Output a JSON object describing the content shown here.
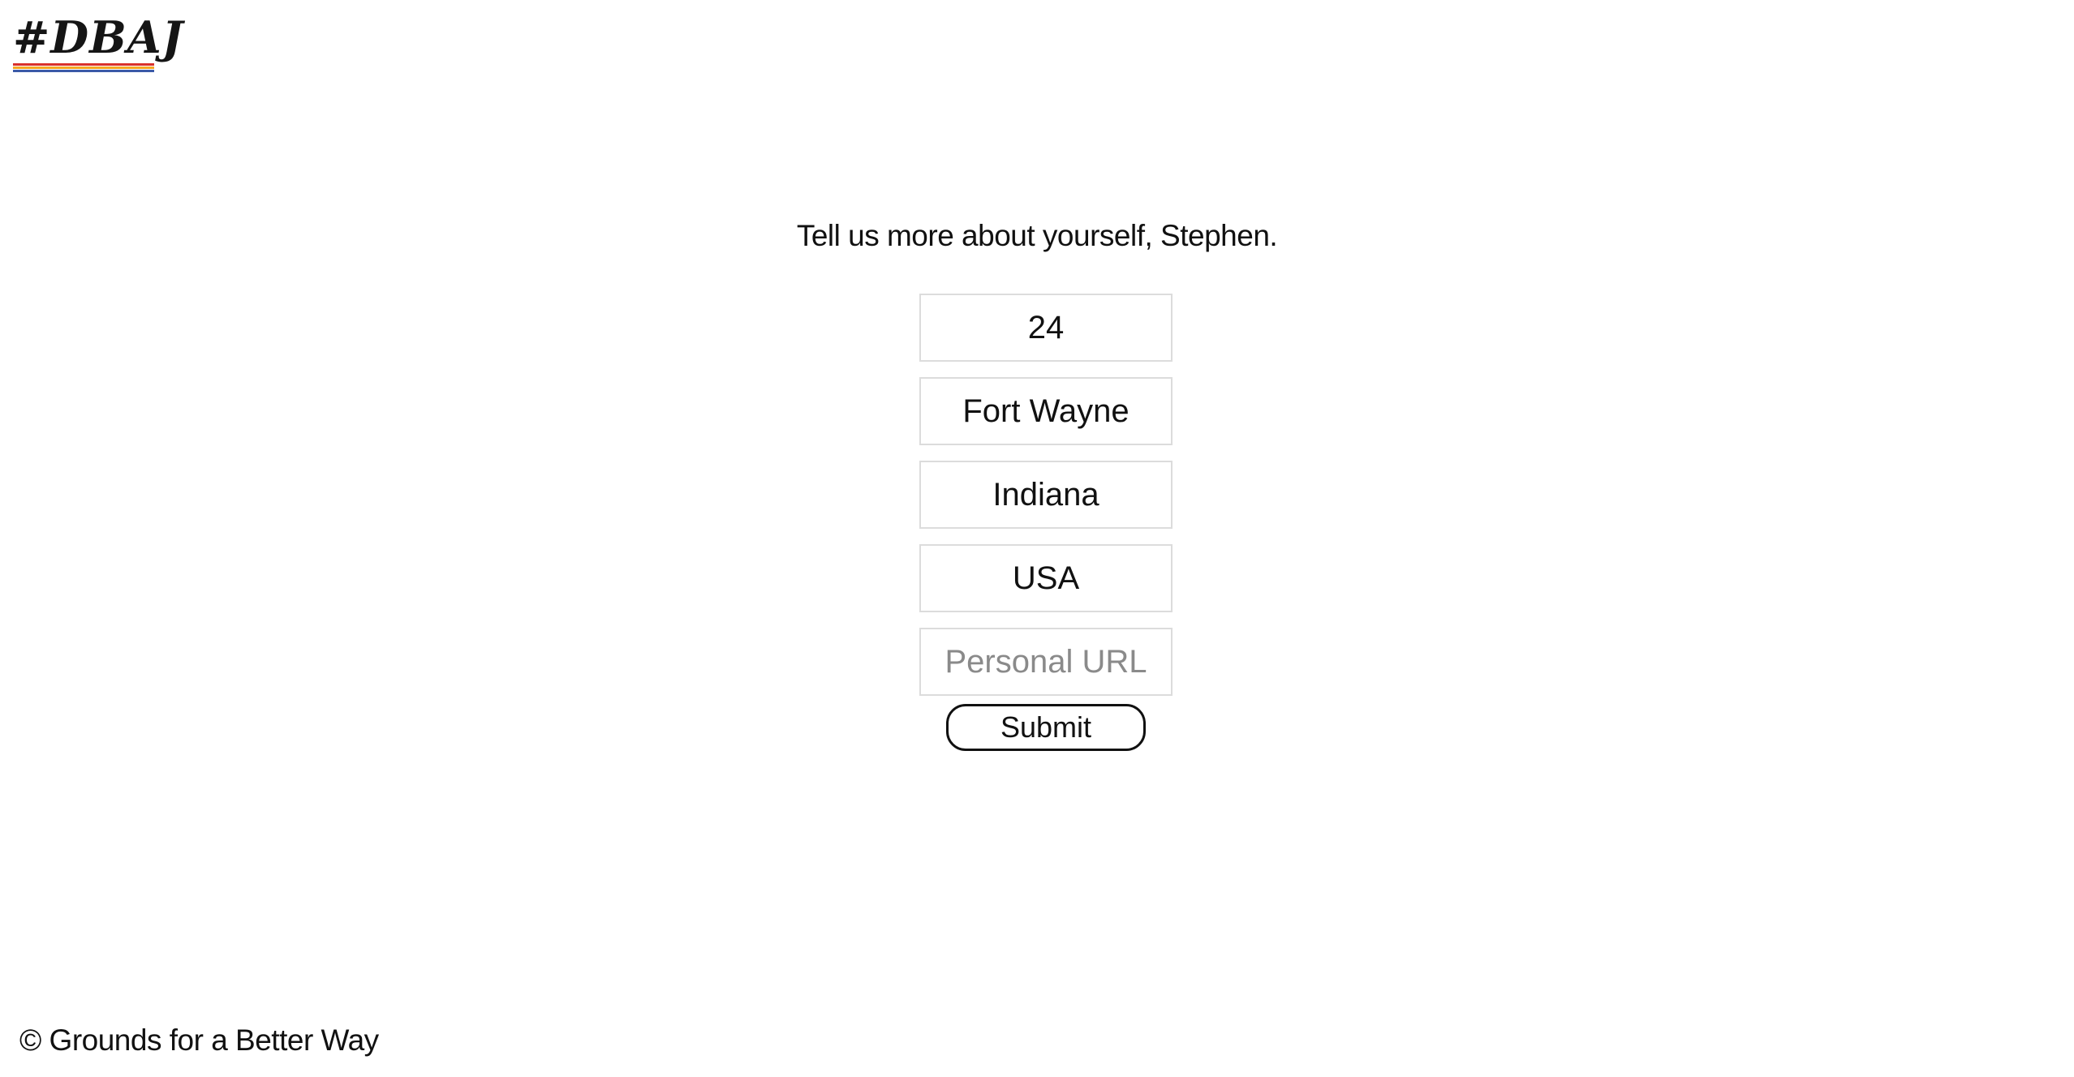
{
  "brand": {
    "logo_text": "#DBAJ",
    "stripe_colors": [
      "#d9302b",
      "#f5a623",
      "#3b5aa8"
    ]
  },
  "intro": {
    "text": "Tell us more about yourself, Stephen."
  },
  "form": {
    "age_value": "24",
    "city_value": "Fort Wayne",
    "state_value": "Indiana",
    "country_value": "USA",
    "url_value": "",
    "url_placeholder": "Personal URL",
    "submit_label": "Submit"
  },
  "footer": {
    "text": "© Grounds for a Better Way"
  }
}
